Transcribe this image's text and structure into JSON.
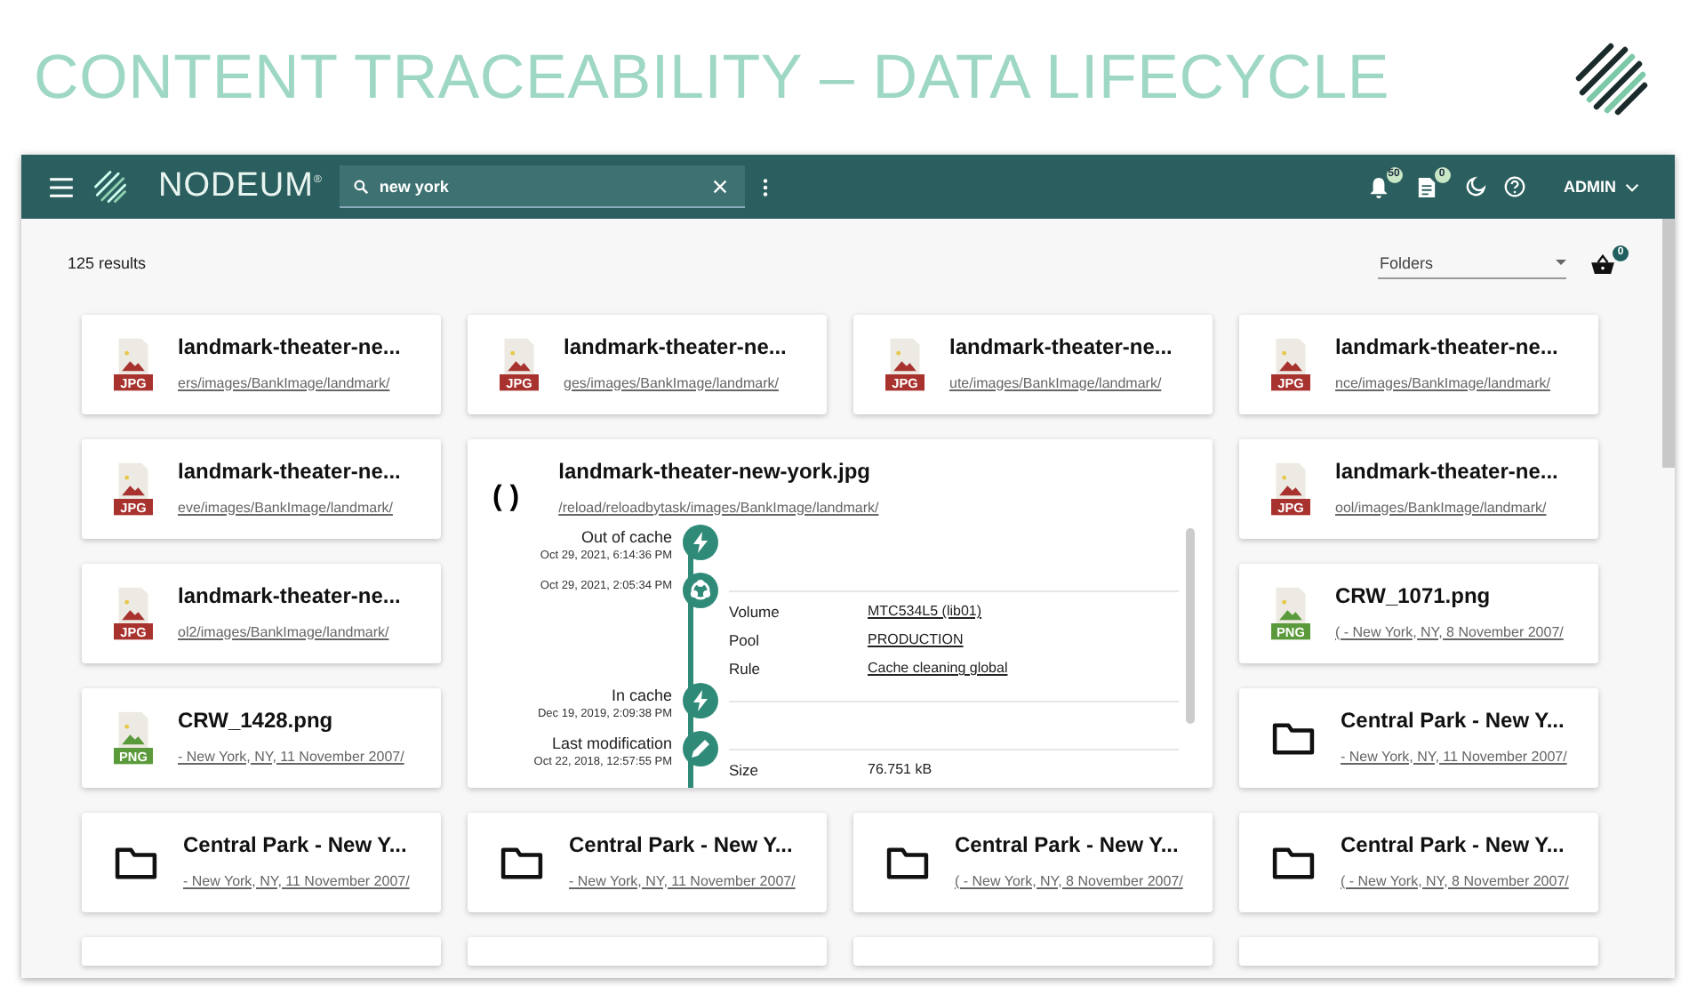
{
  "slide_title": "CONTENT TRACEABILITY – DATA LIFECYCLE",
  "app_bar": {
    "brand": "NODEUM",
    "brand_mark": "®",
    "search": {
      "value": "new york"
    },
    "notifications_badge": "50",
    "tasks_badge": "0",
    "user": "ADMIN"
  },
  "results_count": "125 results",
  "filter": {
    "value": "Folders"
  },
  "basket_badge": "0",
  "cards": [
    {
      "kind": "jpg",
      "type_label": "JPG",
      "title": "landmark-theater-ne...",
      "path": "ers/images/BankImage/landmark/"
    },
    {
      "kind": "jpg",
      "type_label": "JPG",
      "title": "landmark-theater-ne...",
      "path": "ges/images/BankImage/landmark/"
    },
    {
      "kind": "jpg",
      "type_label": "JPG",
      "title": "landmark-theater-ne...",
      "path": "ute/images/BankImage/landmark/"
    },
    {
      "kind": "jpg",
      "type_label": "JPG",
      "title": "landmark-theater-ne...",
      "path": "nce/images/BankImage/landmark/"
    },
    {
      "kind": "jpg",
      "type_label": "JPG",
      "title": "landmark-theater-ne...",
      "path": "eve/images/BankImage/landmark/"
    },
    {
      "kind": "detail"
    },
    {
      "kind": "jpg",
      "type_label": "JPG",
      "title": "landmark-theater-ne...",
      "path": "ool/images/BankImage/landmark/"
    },
    {
      "kind": "jpg",
      "type_label": "JPG",
      "title": "landmark-theater-ne...",
      "path": "ol2/images/BankImage/landmark/"
    },
    {
      "kind": "png",
      "type_label": "PNG",
      "title": "CRW_1071.png",
      "path": "( - New York, NY, 8 November 2007/"
    },
    {
      "kind": "png",
      "type_label": "PNG",
      "title": "CRW_1428.png",
      "path": "- New York, NY, 11 November 2007/"
    },
    {
      "kind": "folder",
      "title": "Central Park - New Y...",
      "path": "- New York, NY, 11 November 2007/"
    },
    {
      "kind": "folder",
      "title": "Central Park - New Y...",
      "path": "- New York, NY, 11 November 2007/"
    },
    {
      "kind": "folder",
      "title": "Central Park - New Y...",
      "path": "- New York, NY, 11 November 2007/"
    },
    {
      "kind": "folder",
      "title": "Central Park - New Y...",
      "path": "( - New York, NY, 8 November 2007/"
    },
    {
      "kind": "folder",
      "title": "Central Park - New Y...",
      "path": "( - New York, NY, 8 November 2007/"
    },
    {
      "kind": "blank"
    },
    {
      "kind": "blank"
    },
    {
      "kind": "blank"
    },
    {
      "kind": "blank"
    }
  ],
  "detail": {
    "marker": "( )",
    "title": "landmark-theater-new-york.jpg",
    "path": "/reload/reloadbytask/images/BankImage/landmark/",
    "events": [
      {
        "kind": "cache",
        "name": "Out of cache",
        "date": "Oct 29, 2021, 6:14:36 PM"
      },
      {
        "kind": "transfer",
        "date": "Oct 29, 2021, 2:05:34 PM",
        "properties": [
          {
            "key": "Volume",
            "value": "MTC534L5 (lib01)",
            "link": true
          },
          {
            "key": "Pool",
            "value": "PRODUCTION",
            "link": true
          },
          {
            "key": "Rule",
            "value": "Cache cleaning global",
            "link": true
          }
        ]
      },
      {
        "kind": "cache",
        "name": "In cache",
        "date": "Dec 19, 2019, 2:09:38 PM"
      },
      {
        "kind": "edit",
        "name": "Last modification",
        "date": "Oct 22, 2018, 12:57:55 PM",
        "properties": [
          {
            "key": "Size",
            "value": "76.751 kB",
            "link": false
          }
        ]
      }
    ]
  }
}
